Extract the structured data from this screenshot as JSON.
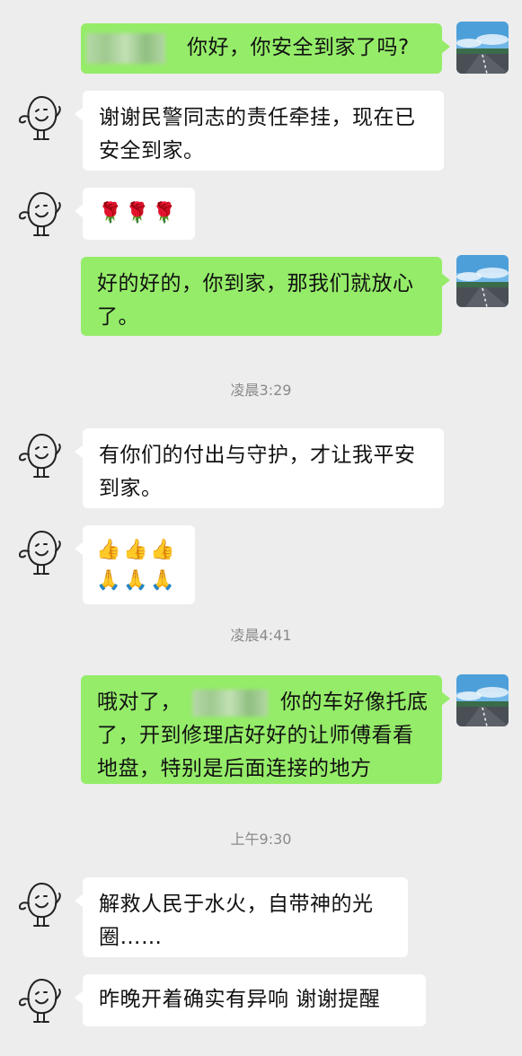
{
  "messages": {
    "m1": {
      "text": "你好，你安全到家了吗?"
    },
    "m2": {
      "line1": "谢谢民警同志的责任牵挂，现在已",
      "line2": "安全到家。"
    },
    "m3": {
      "emoji": "🌹"
    },
    "m4": {
      "line1": "好的好的，你到家，那我们就放心",
      "line2": "了。"
    },
    "m5": {
      "line1": "有你们的付出与守护，才让我平安",
      "line2": "到家。"
    },
    "m6": {
      "emoji_row1": "👍",
      "emoji_row2": "🙏"
    },
    "m7": {
      "line1_pre": "哦对了，",
      "line1_post": "你的车好像托底",
      "line2": "了，开到修理店好好的让师傅看看",
      "line3": "地盘，特别是后面连接的地方"
    },
    "m8": {
      "line1": "解救人民于水火，自带神的光",
      "line2": "圈……"
    },
    "m9": {
      "text": "昨晚开着确实有异响  谢谢提醒"
    }
  },
  "timestamps": {
    "t1": "凌晨3:29",
    "t2": "凌晨4:41",
    "t3": "上午9:30"
  },
  "colors": {
    "background": "#ededed",
    "outgoing_bubble": "#95ec69",
    "incoming_bubble": "#ffffff",
    "timestamp_text": "#8a8a8a"
  },
  "icons": {
    "left_avatar": "doodle-egg-avatar-icon",
    "right_avatar": "road-landscape-avatar-icon",
    "rose": "rose-emoji",
    "thumbs_up": "thumbs-up-emoji",
    "pray": "folded-hands-emoji"
  }
}
